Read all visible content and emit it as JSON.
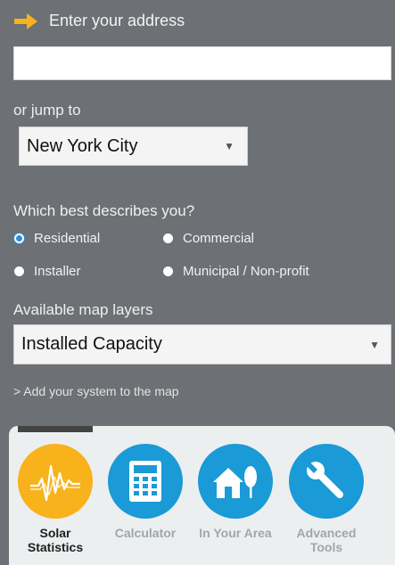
{
  "address": {
    "label": "Enter your address",
    "value": "",
    "placeholder": ""
  },
  "jump": {
    "label": "or jump to",
    "selected": "New York City"
  },
  "describe": {
    "label": "Which best describes you?",
    "options": [
      {
        "label": "Residential",
        "checked": true
      },
      {
        "label": "Commercial",
        "checked": false
      },
      {
        "label": "Installer",
        "checked": false
      },
      {
        "label": "Municipal / Non-profit",
        "checked": false
      }
    ]
  },
  "layers": {
    "label": "Available map layers",
    "selected": "Installed Capacity"
  },
  "add_system_link": "> Add your system to the map",
  "tools": [
    {
      "label": "Solar Statistics",
      "icon": "solar-statistics-icon",
      "active": true
    },
    {
      "label": "Calculator",
      "icon": "calculator-icon",
      "active": false
    },
    {
      "label": "In Your Area",
      "icon": "house-tree-icon",
      "active": false
    },
    {
      "label": "Advanced Tools",
      "icon": "wrench-icon",
      "active": false
    }
  ],
  "colors": {
    "background": "#6d7074",
    "accent": "#f7b21c",
    "tool_blue": "#1a9ad6",
    "radio_selected": "#2b8fdc"
  }
}
